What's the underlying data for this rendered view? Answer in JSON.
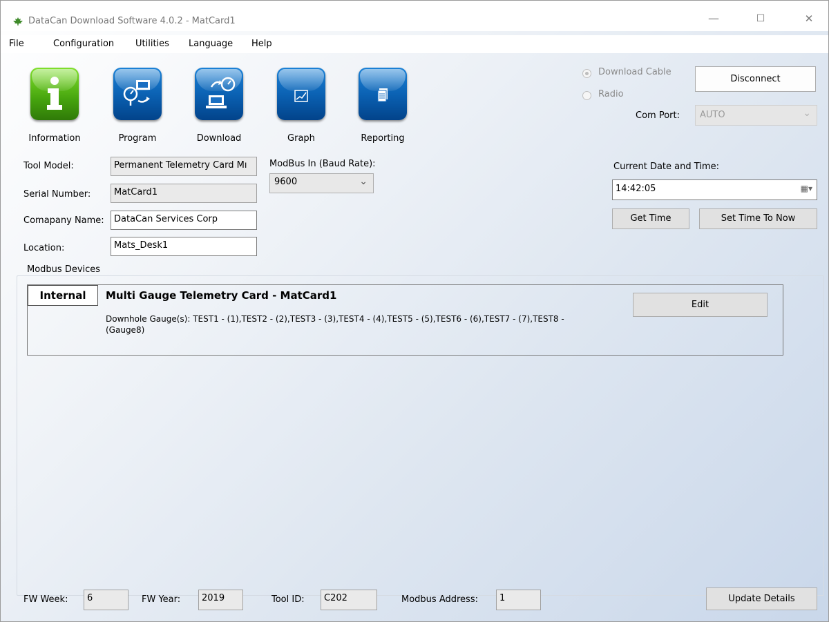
{
  "window": {
    "title": "DataCan Download Software 4.0.2 - MatCard1",
    "controls": {
      "minimize": "—",
      "maximize": "☐",
      "close": "✕"
    }
  },
  "menu": [
    "File",
    "Configuration",
    "Utilities",
    "Language",
    "Help"
  ],
  "toolbar": [
    {
      "label": "Information",
      "icon": "info-icon",
      "color": "#46a40e"
    },
    {
      "label": "Program",
      "icon": "program-icon",
      "color": "#0a5fb0"
    },
    {
      "label": "Download",
      "icon": "download-icon",
      "color": "#0a5fb0"
    },
    {
      "label": "Graph",
      "icon": "graph-icon",
      "color": "#0a5fb0"
    },
    {
      "label": "Reporting",
      "icon": "reporting-icon",
      "color": "#0a5fb0"
    }
  ],
  "connection": {
    "download_cable_label": "Download Cable",
    "radio_label": "Radio",
    "selected": "Download Cable",
    "disconnect_label": "Disconnect",
    "com_port_label": "Com Port:",
    "com_port_value": "AUTO"
  },
  "tool_info": {
    "tool_model_label": "Tool Model:",
    "tool_model_value": "Permanent Telemetry Card Mı",
    "serial_number_label": "Serial Number:",
    "serial_number_value": "MatCard1",
    "company_name_label": "Comapany Name:",
    "company_name_value": "DataCan Services Corp",
    "location_label": "Location:",
    "location_value": "Mats_Desk1",
    "modbus_in_label": "ModBus In (Baud Rate):",
    "modbus_in_value": "9600"
  },
  "datetime": {
    "label": "Current Date and Time:",
    "value": "14:42:05",
    "get_time_label": "Get Time",
    "set_time_label": "Set Time To Now"
  },
  "modbus_devices": {
    "group_title": "Modbus Devices",
    "devices": [
      {
        "tag": "Internal",
        "name": "Multi Gauge Telemetry Card - MatCard1",
        "gauges_line1": "Downhole Gauge(s): TEST1 - (1),TEST2 - (2),TEST3 - (3),TEST4 - (4),TEST5 - (5),TEST6 - (6),TEST7 - (7),TEST8 -",
        "gauges_line2": "(Gauge8)",
        "edit_label": "Edit"
      }
    ]
  },
  "footer": {
    "fw_week_label": "FW Week:",
    "fw_week_value": "6",
    "fw_year_label": "FW Year:",
    "fw_year_value": "2019",
    "tool_id_label": "Tool ID:",
    "tool_id_value": "C202",
    "modbus_address_label": "Modbus Address:",
    "modbus_address_value": "1",
    "update_label": "Update Details"
  }
}
